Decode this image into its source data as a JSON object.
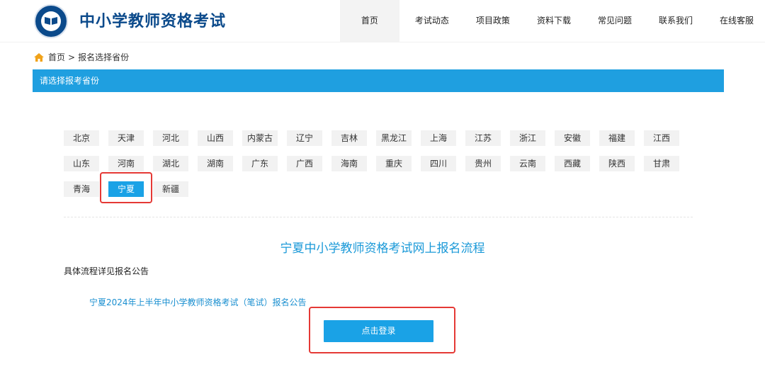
{
  "header": {
    "site_title": "中小学教师资格考试",
    "logo_icon": "education-seal-logo",
    "nav": [
      {
        "label": "首页",
        "active": true
      },
      {
        "label": "考试动态"
      },
      {
        "label": "项目政策"
      },
      {
        "label": "资料下载"
      },
      {
        "label": "常见问题"
      },
      {
        "label": "联系我们"
      },
      {
        "label": "在线客服"
      }
    ]
  },
  "breadcrumb": {
    "home": "首页",
    "separator": ">",
    "current": "报名选择省份",
    "icon": "home-icon"
  },
  "section": {
    "title": "请选择报考省份"
  },
  "provinces": {
    "rows": [
      [
        "北京",
        "天津",
        "河北",
        "山西",
        "内蒙古",
        "辽宁",
        "吉林",
        "黑龙江",
        "上海",
        "江苏",
        "浙江",
        "安徽",
        "福建",
        "江西"
      ],
      [
        "山东",
        "河南",
        "湖北",
        "湖南",
        "广东",
        "广西",
        "海南",
        "重庆",
        "四川",
        "贵州",
        "云南",
        "西藏",
        "陕西",
        "甘肃"
      ],
      [
        "青海",
        "宁夏",
        "新疆"
      ]
    ],
    "selected": "宁夏"
  },
  "flow": {
    "title": "宁夏中小学教师资格考试网上报名流程",
    "subtitle": "具体流程详见报名公告",
    "notice_link": "宁夏2024年上半年中小学教师资格考试（笔试）报名公告",
    "login_button": "点击登录"
  },
  "colors": {
    "accent": "#1aa2e6",
    "brand": "#0b4a8b",
    "highlight": "#e53935"
  }
}
